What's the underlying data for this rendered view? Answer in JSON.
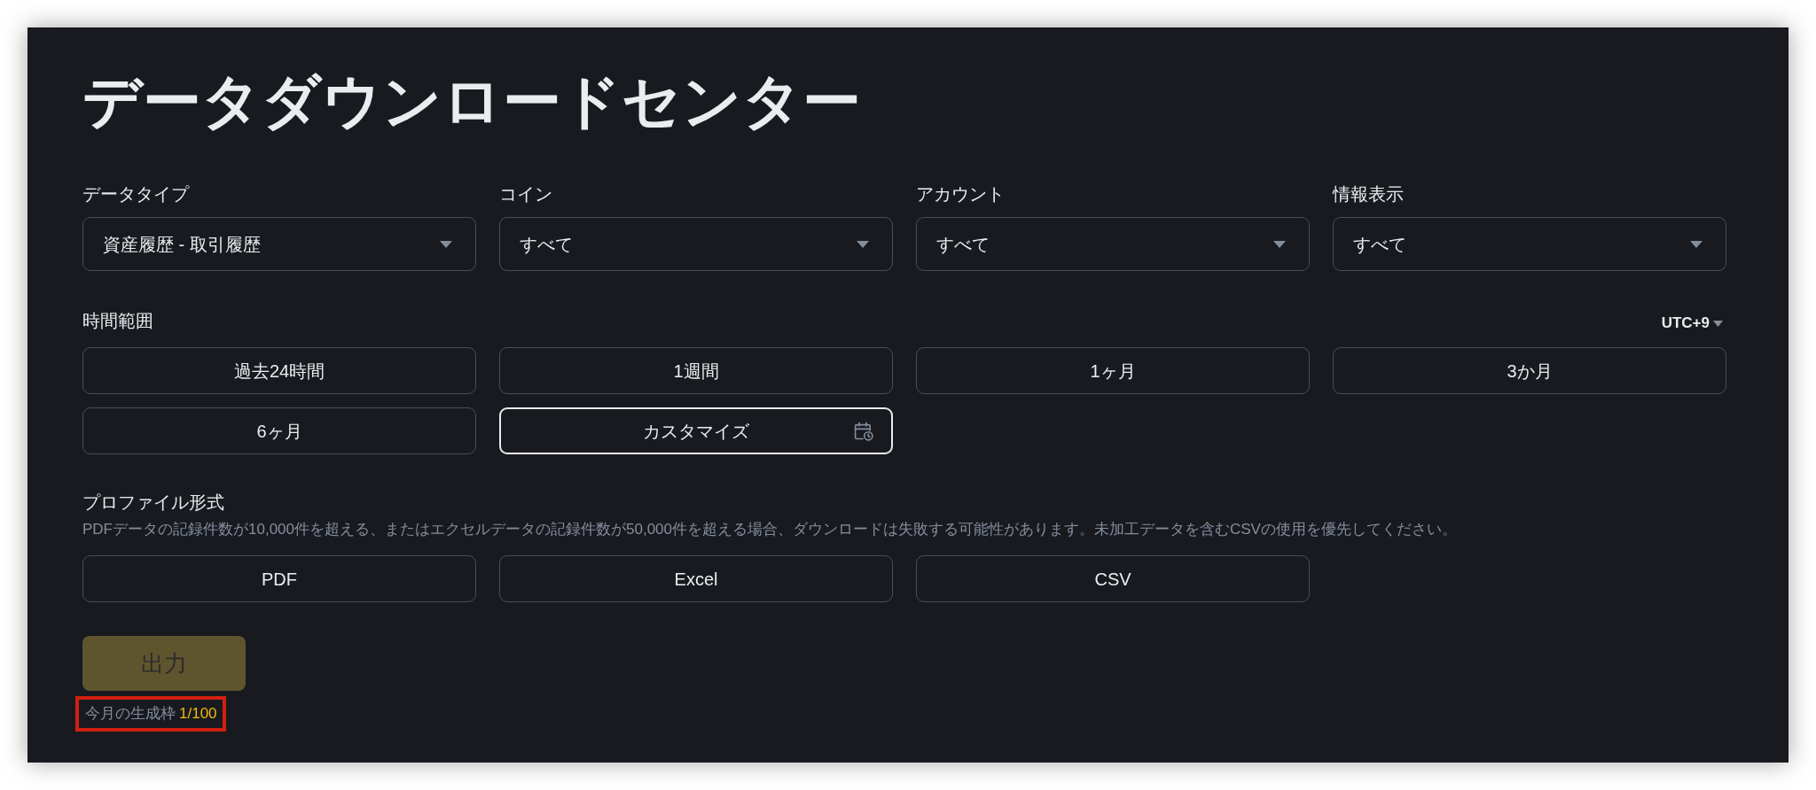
{
  "title": "データダウンロードセンター",
  "filters": [
    {
      "label": "データタイプ",
      "value": "資産履歴 - 取引履歴"
    },
    {
      "label": "コイン",
      "value": "すべて"
    },
    {
      "label": "アカウント",
      "value": "すべて"
    },
    {
      "label": "情報表示",
      "value": "すべて"
    }
  ],
  "time_range": {
    "label": "時間範囲",
    "timezone": "UTC+9",
    "options": [
      {
        "label": "過去24時間",
        "kind": "preset",
        "selected": false
      },
      {
        "label": "1週間",
        "kind": "preset",
        "selected": false
      },
      {
        "label": "1ヶ月",
        "kind": "preset",
        "selected": false
      },
      {
        "label": "3か月",
        "kind": "preset",
        "selected": false
      },
      {
        "label": "6ヶ月",
        "kind": "preset",
        "selected": false
      },
      {
        "label": "カスタマイズ",
        "kind": "custom",
        "selected": true
      }
    ]
  },
  "format": {
    "label": "プロファイル形式",
    "note": "PDFデータの記録件数が10,000件を超える、またはエクセルデータの記録件数が50,000件を超える場合、ダウンロードは失敗する可能性があります。未加工データを含むCSVの使用を優先してください。",
    "options": [
      {
        "label": "PDF",
        "selected": false
      },
      {
        "label": "Excel",
        "selected": false
      },
      {
        "label": "CSV",
        "selected": false
      }
    ]
  },
  "export_button": {
    "label": "出力",
    "disabled": true
  },
  "quota": {
    "label": "今月の生成枠",
    "value": "1/100",
    "highlighted": true
  }
}
